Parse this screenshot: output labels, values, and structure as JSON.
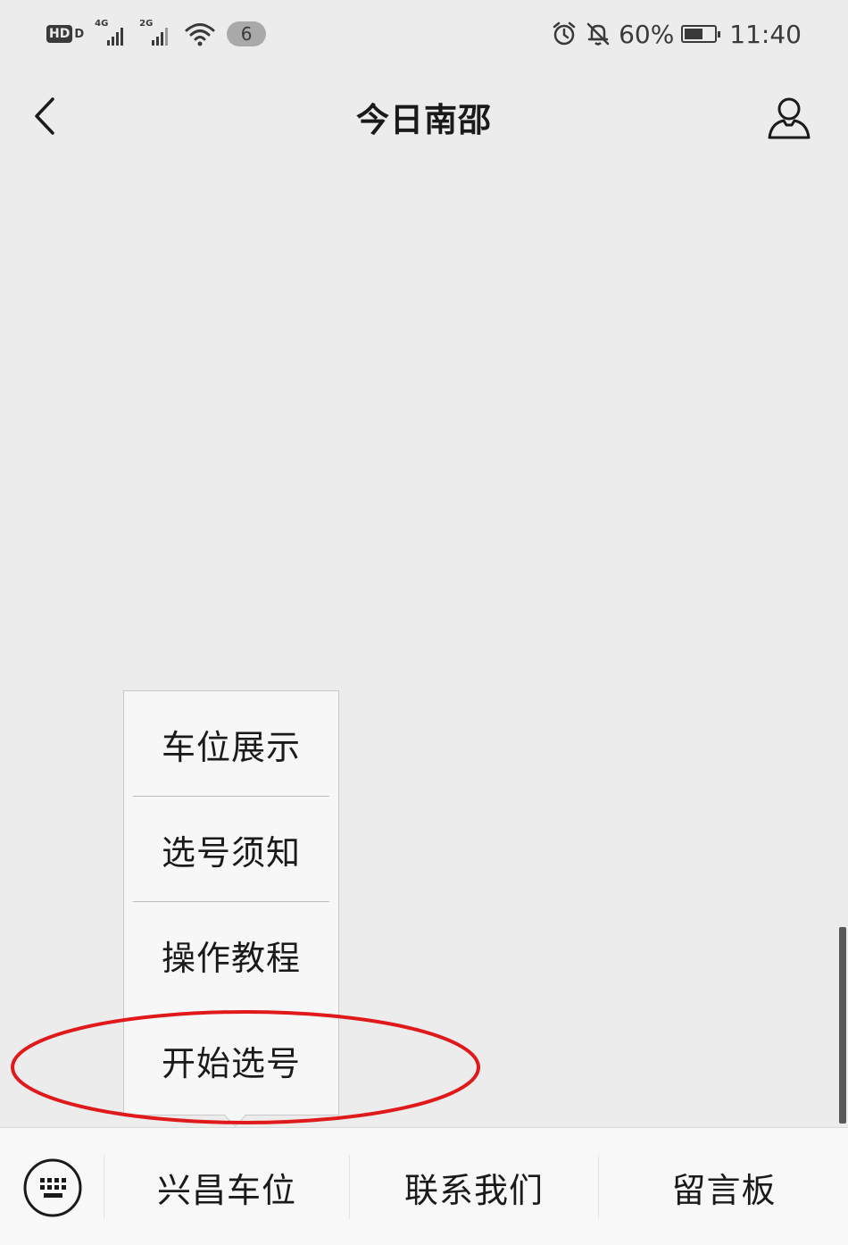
{
  "status_bar": {
    "hd_label": "HD",
    "hd_sub": "D",
    "net1_label": "4G",
    "net2_label": "2G",
    "notification_count": "6",
    "battery_percent": "60%",
    "battery_level": 0.6,
    "time": "11:40",
    "icons": [
      "hd-icon",
      "signal-icon",
      "wifi-icon",
      "alarm-icon",
      "mute-icon",
      "battery-icon"
    ]
  },
  "nav": {
    "title": "今日南邵",
    "back_icon": "chevron-left-icon",
    "profile_icon": "user-icon"
  },
  "popup_menu": {
    "items": [
      {
        "label": "车位展示"
      },
      {
        "label": "选号须知"
      },
      {
        "label": "操作教程"
      },
      {
        "label": "开始选号"
      }
    ],
    "highlighted_item": "开始选号",
    "highlight_color": "#e0191b"
  },
  "bottom_menu": {
    "keyboard_icon": "keyboard-icon",
    "tabs": [
      {
        "label": "兴昌车位"
      },
      {
        "label": "联系我们"
      },
      {
        "label": "留言板"
      }
    ]
  }
}
